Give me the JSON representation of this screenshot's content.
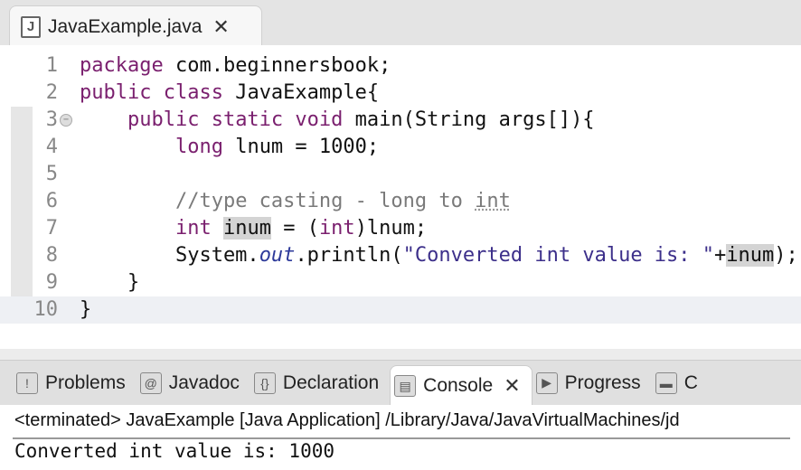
{
  "editor": {
    "tab_label": "JavaExample.java",
    "lines": [
      {
        "n": "1",
        "tokens": [
          [
            "package",
            "kw"
          ],
          " com.beginnersbook;"
        ]
      },
      {
        "n": "2",
        "tokens": [
          [
            "public class",
            "kw"
          ],
          " JavaExample{"
        ]
      },
      {
        "n": "3",
        "fold": true,
        "tokens": [
          "    ",
          [
            "public static void",
            "kw"
          ],
          " main(String args[]){"
        ]
      },
      {
        "n": "4",
        "tokens": [
          "        ",
          [
            "long",
            "kw"
          ],
          " lnum = 1000;"
        ]
      },
      {
        "n": "5",
        "tokens": []
      },
      {
        "n": "6",
        "tokens": [
          "        ",
          [
            "//type casting - long to ",
            "cm"
          ],
          [
            "int",
            "cm ul"
          ]
        ]
      },
      {
        "n": "7",
        "tokens": [
          "        ",
          [
            "int",
            "kw"
          ],
          " ",
          [
            "inum",
            "hl"
          ],
          " = (",
          [
            "int",
            "kw"
          ],
          ")lnum;"
        ]
      },
      {
        "n": "8",
        "tokens": [
          "        System.",
          [
            "out",
            "it"
          ],
          ".println(",
          [
            "\"Converted int value is: \"",
            "st"
          ],
          "+",
          [
            "inum",
            "hl"
          ],
          ");"
        ]
      },
      {
        "n": "9",
        "tokens": [
          "    }"
        ]
      },
      {
        "n": "10",
        "tokens": [
          "}"
        ]
      }
    ]
  },
  "panel": {
    "tabs": [
      {
        "label": "Problems",
        "icon": "problems-icon",
        "glyph": "!"
      },
      {
        "label": "Javadoc",
        "icon": "at-icon",
        "glyph": "@"
      },
      {
        "label": "Declaration",
        "icon": "declaration-icon",
        "glyph": "{}"
      },
      {
        "label": "Console",
        "icon": "console-icon",
        "glyph": "▤",
        "active": true
      },
      {
        "label": "Progress",
        "icon": "progress-icon",
        "glyph": "▶"
      },
      {
        "label": "C",
        "icon": "coverage-icon",
        "glyph": "▬"
      }
    ],
    "close_glyph": "✕",
    "terminated": "<terminated> JavaExample [Java Application] /Library/Java/JavaVirtualMachines/jd",
    "output": "Converted int value is: 1000"
  }
}
